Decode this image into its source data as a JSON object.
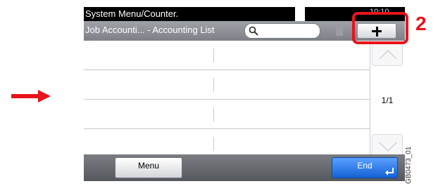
{
  "panel": {
    "title": "System Menu/Counter.",
    "clock": "10:10",
    "subtitle": "Job Accounti... - Accounting List",
    "search": {
      "placeholder": ""
    },
    "add_button": "+",
    "list": {
      "rows": 4
    },
    "pager": {
      "page": "1/1"
    },
    "menu_label": "Menu",
    "end_label": "End"
  },
  "annotation": {
    "step_number": "2",
    "figure_id": "GB0473_01",
    "accent": "#e8141c"
  }
}
